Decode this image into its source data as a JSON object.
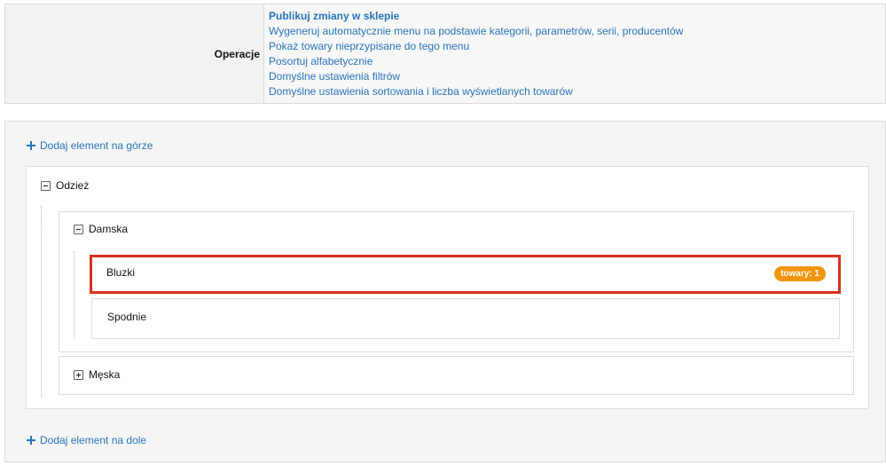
{
  "operations": {
    "label": "Operacje",
    "links": [
      "Publikuj zmiany w sklepie",
      "Wygeneruj automatycznie menu na podstawie kategorii, parametrów, serii, producentów",
      "Pokaż towary nieprzypisane do tego menu",
      "Posortuj alfabetycznie",
      "Domyślne ustawienia filtrów",
      "Domyślne ustawienia sortowania i liczba wyświetlanych towarów"
    ]
  },
  "tree": {
    "add_top": "Dodaj element na górze",
    "add_bottom": "Dodaj element na dole",
    "root": {
      "label": "Odzież",
      "children": {
        "damska": {
          "label": "Damska",
          "items": {
            "bluzki": {
              "label": "Bluzki",
              "badge": "towary: 1"
            },
            "spodnie": {
              "label": "Spodnie"
            }
          }
        },
        "meska": {
          "label": "Męska"
        }
      }
    }
  },
  "colors": {
    "link": "#2a73b8",
    "highlight": "#d9321f",
    "badge": "#f0960e"
  }
}
